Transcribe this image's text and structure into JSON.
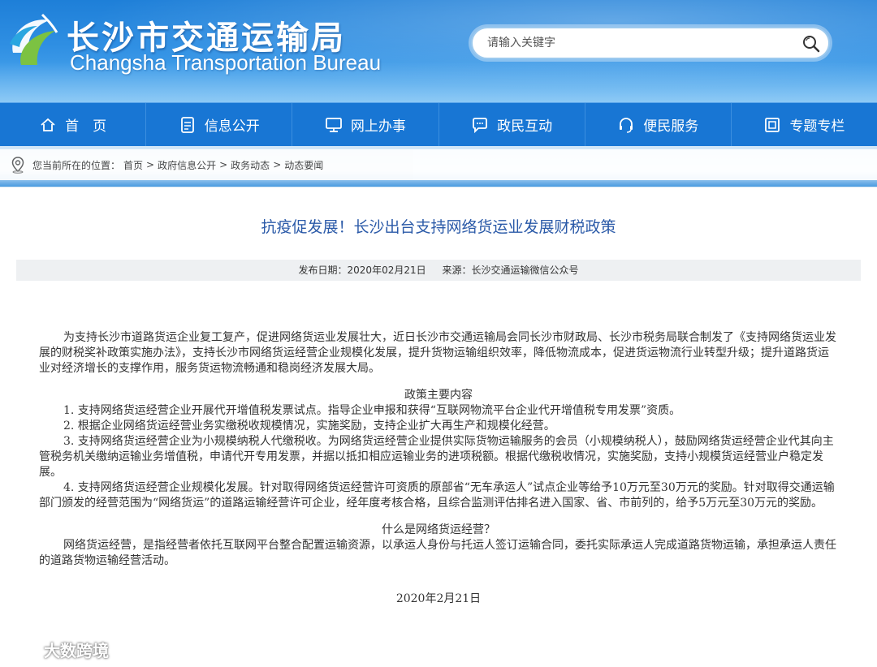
{
  "header": {
    "title_cn": "长沙市交通运输局",
    "title_en": "Changsha Transportation Bureau",
    "logo_icon": "changsha-transport-logo",
    "search": {
      "placeholder": "请输入关键字",
      "icon": "search-icon"
    }
  },
  "nav": {
    "items": [
      {
        "label": "首　页",
        "icon": "home-icon"
      },
      {
        "label": "信息公开",
        "icon": "document-icon"
      },
      {
        "label": "网上办事",
        "icon": "monitor-icon"
      },
      {
        "label": "政民互动",
        "icon": "chat-icon"
      },
      {
        "label": "便民服务",
        "icon": "headset-icon"
      },
      {
        "label": "专题专栏",
        "icon": "topic-icon"
      }
    ]
  },
  "breadcrumb": {
    "prefix": "您当前所在的位置：",
    "items": [
      "首页",
      "政府信息公开",
      "政务动态",
      "动态要闻"
    ],
    "separator": ">"
  },
  "article": {
    "title": "抗疫促发展！长沙出台支持网络货运业发展财税政策",
    "publish_date": "发布日期：2020年02月21日",
    "source": "来源：长沙交通运输微信公众号",
    "intro": "为支持长沙市道路货运企业复工复产，促进网络货运业发展壮大，近日长沙市交通运输局会同长沙市财政局、长沙市税务局联合制发了《支持网络货运业发展的财税奖补政策实施办法》，支持长沙市网络货运经营企业规模化发展，提升货物运输组织效率，降低物流成本，促进货运物流行业转型升级；提升道路货运业对经济增长的支撑作用，服务货运物流畅通和稳岗经济发展大局。",
    "policy_heading": "政策主要内容",
    "policy_items": [
      "1. 支持网络货运经营企业开展代开增值税发票试点。指导企业申报和获得“互联网物流平台企业代开增值税专用发票”资质。",
      "2. 根据企业网络货运经营业务实缴税收规模情况，实施奖励，支持企业扩大再生产和规模化经营。",
      "3. 支持网络货运经营企业为小规模纳税人代缴税收。为网络货运经营企业提供实际货物运输服务的会员（小规模纳税人），鼓励网络货运经营企业代其向主管税务机关缴纳运输业务增值税，申请代开专用发票，并据以抵扣相应运输业务的进项税额。根据代缴税收情况，实施奖励，支持小规模货运经营业户稳定发展。",
      "4. 支持网络货运经营企业规模化发展。针对取得网络货运经营许可资质的原部省“无车承运人”试点企业等给予10万元至30万元的奖励。针对取得交通运输部门颁发的经营范围为“网络货运”的道路运输经营许可企业，经年度考核合格，且综合监测评估排名进入国家、省、市前列的，给予5万元至30万元的奖励。"
    ],
    "faq_heading": "什么是网络货运经营？",
    "faq_text": "网络货运经营，是指经营者依托互联网平台整合配置运输资源，以承运人身份与托运人签订运输合同，委托实际承运人完成道路货物运输，承担承运人责任的道路货物运输经营活动。",
    "sign_date": "2020年2月21日"
  },
  "watermark": "大数跨境",
  "colors": {
    "nav": "#1876d4",
    "title": "#2b5aa8",
    "header_top": "#1e7fd8"
  }
}
